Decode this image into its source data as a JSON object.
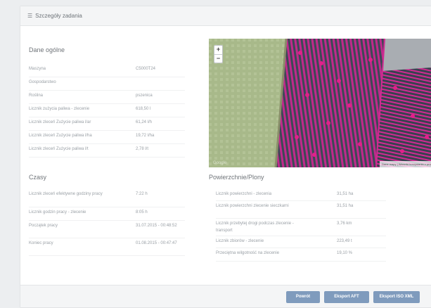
{
  "header": {
    "icon": "tasks-icon",
    "title": "Szczegóły zadania"
  },
  "general": {
    "title": "Dane ogólne",
    "rows": [
      {
        "label": "Maszyna",
        "value": "C5000T24"
      },
      {
        "label": "Gospodarstwo",
        "value": ""
      },
      {
        "label": "Roślina",
        "value": "pszenica"
      },
      {
        "label": "Licznik zużycia paliwa - zlecenie",
        "value": "618,50 l"
      },
      {
        "label": "Licznik zleceń Zużycie paliwa l/ar",
        "value": "61,24 l/h"
      },
      {
        "label": "Licznik zleceń Zużycie paliwa l/ha",
        "value": "19,72 l/ha"
      },
      {
        "label": "Licznik zleceń Zużycie paliwa l/t",
        "value": "2,78 l/t"
      }
    ]
  },
  "times": {
    "title": "Czasy",
    "rows": [
      {
        "label": "Licznik zleceń efektywne godziny pracy",
        "value": "7:22 h"
      },
      {
        "label": "Licznik godzin pracy - zlecenie",
        "value": "8:05 h"
      },
      {
        "label": "Początek pracy",
        "value": "31.07.2015 - 00:48:52"
      },
      {
        "label": "Koniec pracy",
        "value": "01.08.2015 - 00:47:47"
      }
    ]
  },
  "areas": {
    "title": "Powierzchnie/Plony",
    "rows": [
      {
        "label": "Licznik powierzchni - zlecenia",
        "value": "31,51 ha"
      },
      {
        "label": "Licznik powierzchni zlecenie sieczkarni",
        "value": "31,51 ha"
      },
      {
        "label": "Licznik przebytej drogi podczas zlecenie - transport",
        "value": "3,76 km"
      },
      {
        "label": "Licznik zbiorów - zlecenie",
        "value": "223,49 t"
      },
      {
        "label": "Przeciętna wilgotność na zlecenie",
        "value": "19,10 %"
      }
    ]
  },
  "map": {
    "zoom_in": "+",
    "zoom_out": "−",
    "attribution": "Dane mapy | Warunki korzystania z programu",
    "brand": "Google",
    "track_color": "#e0218a"
  },
  "footer": {
    "close_label": "Powrót",
    "export_aft_label": "Eksport AFT",
    "export_iso_label": "Eksport ISO XML"
  }
}
